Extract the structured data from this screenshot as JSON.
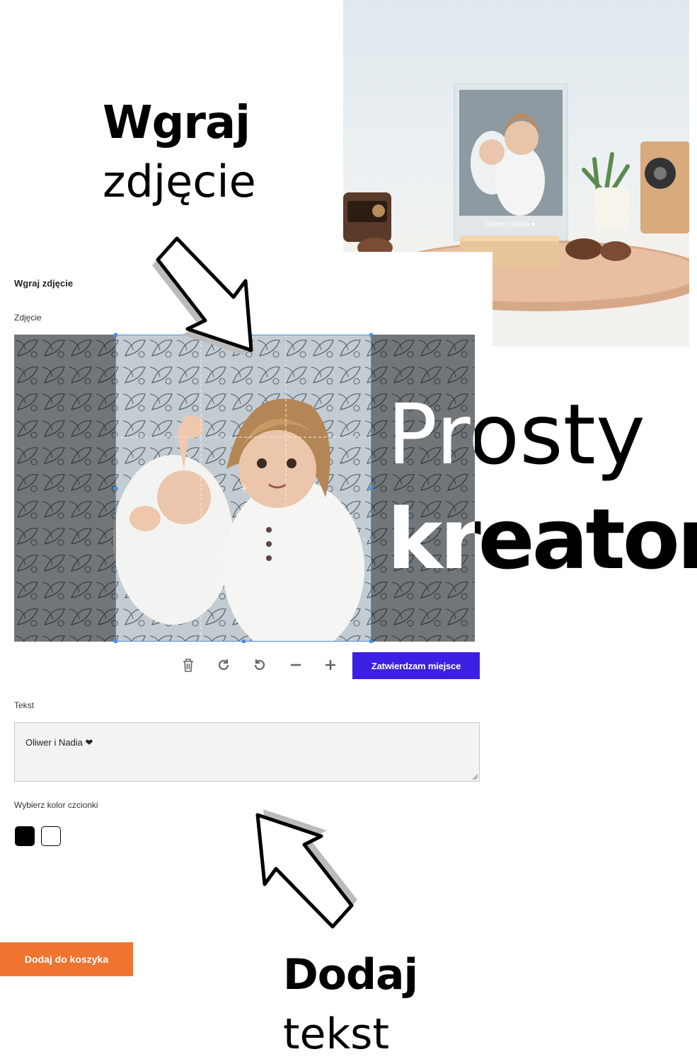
{
  "promo": {
    "upload_bold": "Wgraj",
    "upload_light": "zdjęcie",
    "creator_light": "Prosty",
    "creator_bold": "kreator",
    "text_bold": "Dodaj",
    "text_light": "tekst"
  },
  "product": {
    "plaque_caption": "Oliwer i Nadia ♥"
  },
  "creator": {
    "section_title": "Wgraj zdjęcie",
    "photo_label": "Zdjęcie",
    "toolbar": {
      "delete_icon": "trash-icon",
      "rotate_right_icon": "rotate-right-icon",
      "rotate_left_icon": "rotate-left-icon",
      "zoom_out_icon": "minus-icon",
      "zoom_in_icon": "plus-icon",
      "confirm_label": "Zatwierdzam miejsce",
      "confirm_color": "#3b1fe3"
    },
    "text_label": "Tekst",
    "text_value": "Oliwer i Nadia ❤",
    "font_color_label": "Wybierz kolor czcionki",
    "font_colors": [
      "#000000",
      "#ffffff"
    ],
    "add_to_cart_label": "Dodaj do koszyka",
    "add_to_cart_color": "#ee7430"
  }
}
